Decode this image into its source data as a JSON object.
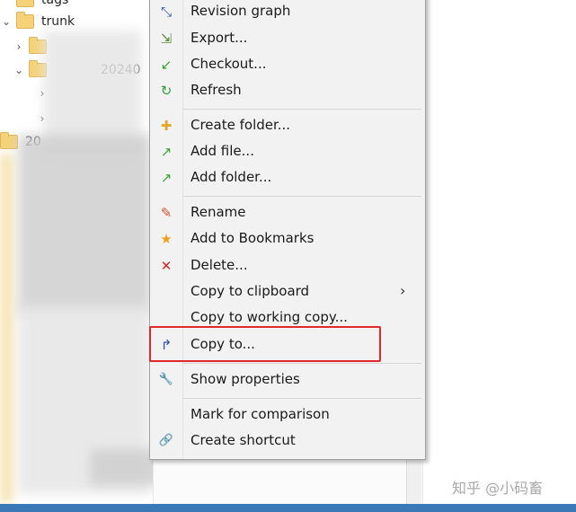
{
  "tree": {
    "rows": [
      {
        "label": "tags",
        "expanded": false
      },
      {
        "label": "trunk",
        "expanded": true
      },
      {
        "label": "",
        "expanded": false
      },
      {
        "label": "20240",
        "expanded": true
      },
      {
        "label": "",
        "expanded": false
      },
      {
        "label": "",
        "expanded": false
      },
      {
        "label": "20",
        "expanded": false
      }
    ]
  },
  "menu": {
    "items": [
      {
        "label": "Revision graph",
        "icon": "revision-graph-icon",
        "glyph": "⤡",
        "color": "#2b4fa8"
      },
      {
        "label": "Export...",
        "icon": "export-icon",
        "glyph": "⇲",
        "color": "#5a8a3a"
      },
      {
        "label": "Checkout...",
        "icon": "checkout-icon",
        "glyph": "↙",
        "color": "#3aa03a"
      },
      {
        "label": "Refresh",
        "icon": "refresh-icon",
        "glyph": "↻",
        "color": "#2e9e3e"
      },
      {
        "label": "Create folder...",
        "icon": "create-folder-icon",
        "glyph": "✚",
        "color": "#e0a82a"
      },
      {
        "label": "Add file...",
        "icon": "add-file-icon",
        "glyph": "↗",
        "color": "#3aa03a"
      },
      {
        "label": "Add folder...",
        "icon": "add-folder-icon",
        "glyph": "↗",
        "color": "#3aa03a"
      },
      {
        "label": "Rename",
        "icon": "rename-icon",
        "glyph": "✎",
        "color": "#d2562a"
      },
      {
        "label": "Add to Bookmarks",
        "icon": "bookmark-star-icon",
        "glyph": "★",
        "color": "#f0a020"
      },
      {
        "label": "Delete...",
        "icon": "delete-icon",
        "glyph": "✕",
        "color": "#d62828"
      },
      {
        "label": "Copy to clipboard",
        "icon": "",
        "glyph": "",
        "color": "#000000",
        "submenu": "›"
      },
      {
        "label": "Copy to working copy...",
        "icon": "",
        "glyph": "",
        "color": "#000000"
      },
      {
        "label": "Copy to...",
        "icon": "copy-to-icon",
        "glyph": "↱",
        "color": "#2b4fa8"
      },
      {
        "label": "Show properties",
        "icon": "properties-wrench-icon",
        "glyph": "🔧",
        "color": "#888888"
      },
      {
        "label": "Mark for comparison",
        "icon": "",
        "glyph": "",
        "color": "#000000"
      },
      {
        "label": "Create shortcut",
        "icon": "shortcut-icon",
        "glyph": "🔗",
        "color": "#888888"
      }
    ]
  },
  "watermark": "知乎 @小码畜",
  "colors": {
    "highlight_border": "#e0282d",
    "menu_background": "#f2f2f2"
  }
}
